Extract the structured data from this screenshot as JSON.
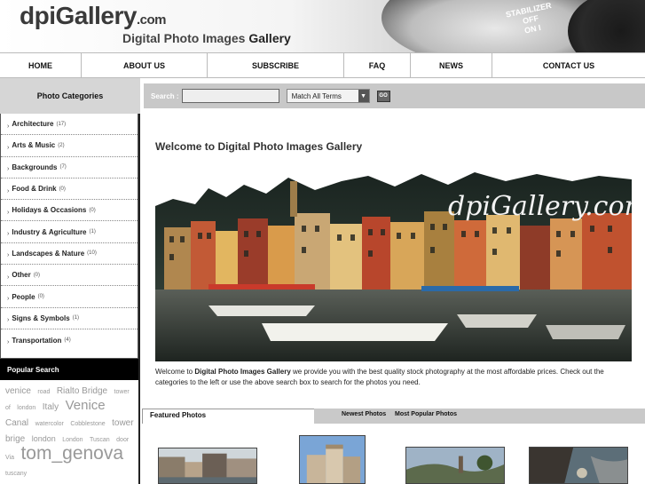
{
  "header": {
    "logo_main": "dpiGallery",
    "logo_suffix": ".com",
    "tagline_main": "Digital Photo Images ",
    "tagline_strong": "Gallery"
  },
  "nav": {
    "items": [
      {
        "label": "HOME"
      },
      {
        "label": "ABOUT US"
      },
      {
        "label": "SUBSCRIBE"
      },
      {
        "label": "FAQ"
      },
      {
        "label": "NEWS"
      },
      {
        "label": "CONTACT US"
      }
    ]
  },
  "categories_title": "Photo Categories",
  "search": {
    "label": "Search :",
    "value": "",
    "match_selected": "Match All Terms",
    "go_label": "GO"
  },
  "categories": [
    {
      "name": "Architecture",
      "count": "(17)"
    },
    {
      "name": "Arts & Music",
      "count": "(2)"
    },
    {
      "name": "Backgrounds",
      "count": "(7)"
    },
    {
      "name": "Food & Drink",
      "count": "(0)"
    },
    {
      "name": "Holidays & Occasions",
      "count": "(0)"
    },
    {
      "name": "Industry & Agriculture",
      "count": "(1)"
    },
    {
      "name": "Landscapes & Nature",
      "count": "(10)"
    },
    {
      "name": "Other",
      "count": "(0)"
    },
    {
      "name": "People",
      "count": "(0)"
    },
    {
      "name": "Signs & Symbols",
      "count": "(1)"
    },
    {
      "name": "Transportation",
      "count": "(4)"
    }
  ],
  "popular_search": {
    "title": "Popular Search",
    "tags": [
      {
        "text": "venice",
        "size": 10
      },
      {
        "text": "road",
        "size": 7
      },
      {
        "text": "Rialto Bridge",
        "size": 10
      },
      {
        "text": "tower of",
        "size": 7
      },
      {
        "text": "london",
        "size": 7
      },
      {
        "text": "Italy",
        "size": 10
      },
      {
        "text": "Venice",
        "size": 15
      },
      {
        "text": "Canal",
        "size": 10
      },
      {
        "text": "watercolor",
        "size": 7
      },
      {
        "text": "Cobblestone",
        "size": 7
      },
      {
        "text": "tower brige",
        "size": 10
      },
      {
        "text": "london",
        "size": 9
      },
      {
        "text": "London",
        "size": 7
      },
      {
        "text": "Tuscan",
        "size": 7
      },
      {
        "text": "door",
        "size": 7
      },
      {
        "text": "Via",
        "size": 7
      },
      {
        "text": "tom_genova",
        "size": 21
      },
      {
        "text": "tuscany",
        "size": 7
      }
    ]
  },
  "main": {
    "welcome_title": "Welcome to Digital Photo Images Gallery",
    "hero_watermark": "dpiGallery.com",
    "intro_prefix": "Welcome to ",
    "intro_strong": "Digital Photo Images Gallery",
    "intro_rest": " we provide you with the best quality stock photography at the most affordable prices. Check out the categories to the left or use the above search box to search for the photos you need."
  },
  "tabs": {
    "featured": "Featured Photos",
    "newest": "Newest Photos",
    "popular": "Most Popular Photos"
  },
  "colors": {
    "sidebar_border": "#222222",
    "popular_bg": "#000000",
    "searchbar_bg": "#c8c8c8",
    "tag_color": "#999999"
  }
}
